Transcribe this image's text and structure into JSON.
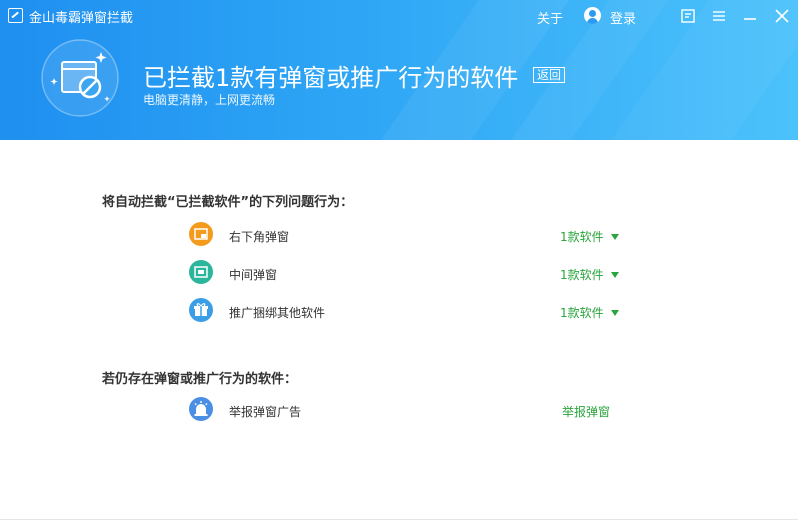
{
  "app": {
    "title": "金山毒霸弹窗拦截"
  },
  "titlebar": {
    "about": "关于",
    "login": "登录"
  },
  "hero": {
    "title": "已拦截1款有弹窗或推广行为的软件",
    "back": "返回",
    "subtitle": "电脑更清静，上网更流畅"
  },
  "section1": {
    "title": "将自动拦截“已拦截软件”的下列问题行为：",
    "items": [
      {
        "label": "右下角弹窗",
        "count": "1款软件",
        "icon": "popup-corner-icon",
        "color": "#f29b1d"
      },
      {
        "label": "中间弹窗",
        "count": "1款软件",
        "icon": "popup-center-icon",
        "color": "#2bb59a"
      },
      {
        "label": "推广捆绑其他软件",
        "count": "1款软件",
        "icon": "bundle-box-icon",
        "color": "#3a9ee6"
      }
    ]
  },
  "section2": {
    "title": "若仍存在弹窗或推广行为的软件：",
    "items": [
      {
        "label": "举报弹窗广告",
        "action": "举报弹窗",
        "icon": "alarm-icon",
        "color": "#4a8fe3"
      }
    ]
  },
  "colors": {
    "header_start": "#1f8ff0",
    "header_end": "#4cc2fb",
    "accent_green": "#2aa43c"
  }
}
